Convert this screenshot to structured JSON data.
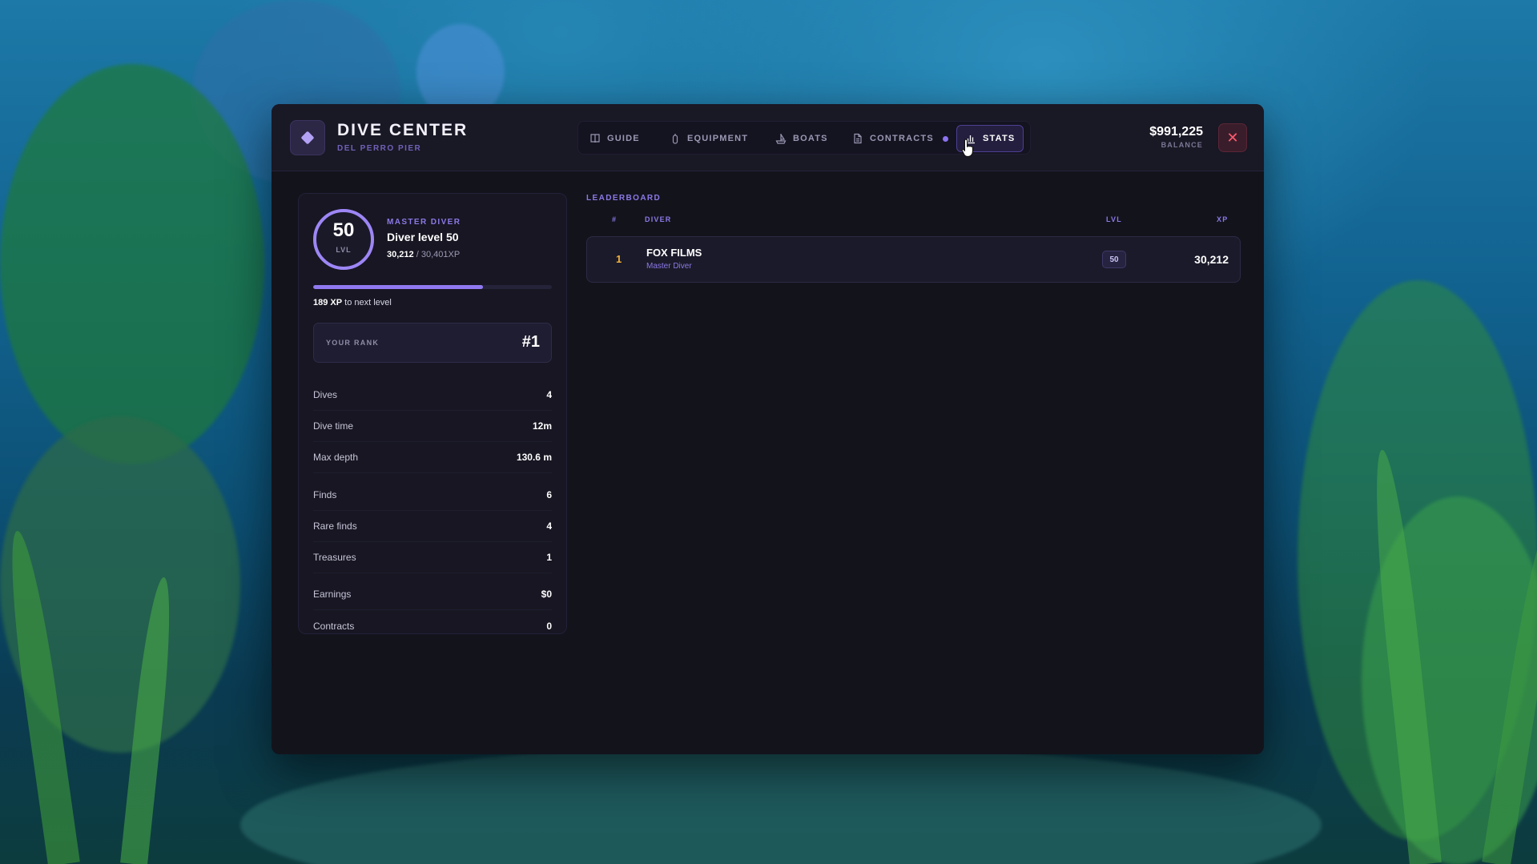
{
  "header": {
    "title": "DIVE CENTER",
    "subtitle": "DEL PERRO PIER",
    "balance_amount": "$991,225",
    "balance_label": "BALANCE"
  },
  "tabs": [
    {
      "label": "GUIDE",
      "icon": "book-icon"
    },
    {
      "label": "EQUIPMENT",
      "icon": "tank-icon"
    },
    {
      "label": "BOATS",
      "icon": "boat-icon"
    },
    {
      "label": "CONTRACTS",
      "icon": "document-icon"
    },
    {
      "label": "STATS",
      "icon": "bar-chart-icon"
    }
  ],
  "active_tab": "STATS",
  "profile": {
    "level": "50",
    "level_label": "LVL",
    "rank_title": "MASTER DIVER",
    "level_text": "Diver level 50",
    "xp_current": "30,212",
    "xp_total": "/ 30,401XP",
    "xp_progress_fraction": 0.71,
    "xp_to_next": "189 XP",
    "xp_to_next_suffix": "to next level",
    "your_rank_label": "YOUR RANK",
    "your_rank_value": "#1"
  },
  "stats": [
    {
      "label": "Dives",
      "value": "4"
    },
    {
      "label": "Dive time",
      "value": "12m"
    },
    {
      "label": "Max depth",
      "value": "130.6 m"
    },
    {
      "label": "Finds",
      "value": "6"
    },
    {
      "label": "Rare finds",
      "value": "4"
    },
    {
      "label": "Treasures",
      "value": "1"
    },
    {
      "label": "Earnings",
      "value": "$0"
    },
    {
      "label": "Contracts",
      "value": "0"
    }
  ],
  "leaderboard": {
    "title": "LEADERBOARD",
    "columns": [
      "#",
      "DIVER",
      "LVL",
      "XP"
    ],
    "rows": [
      {
        "position": "1",
        "name": "FOX FILMS",
        "subtitle": "Master Diver",
        "level": "50",
        "xp": "30,212"
      }
    ]
  },
  "colors": {
    "accent": "#8b79e6",
    "gold": "#f2b23d",
    "close_red": "#ff5a6e"
  }
}
